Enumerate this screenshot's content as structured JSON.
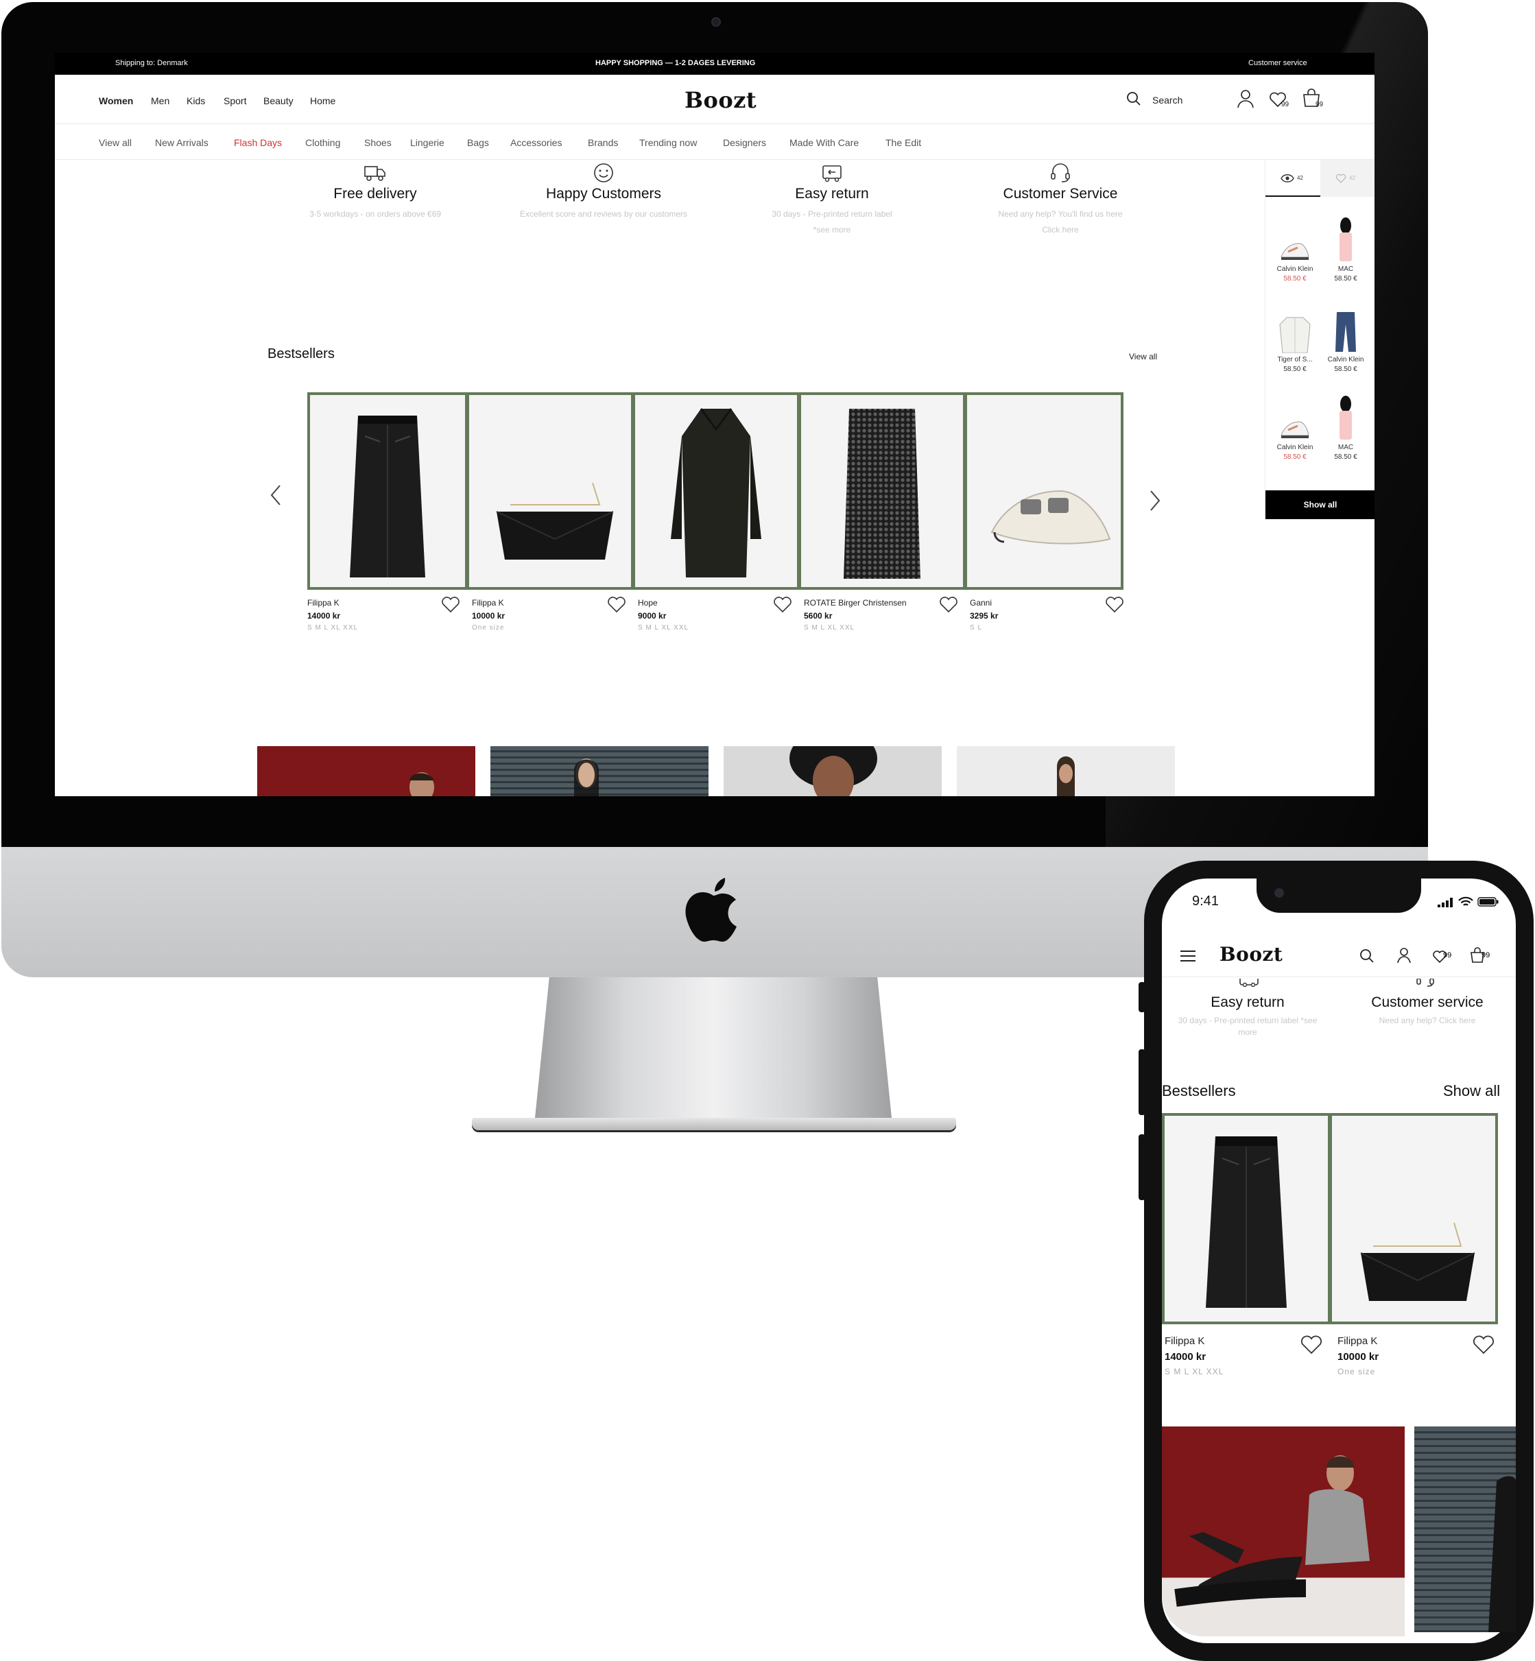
{
  "desktop": {
    "topbar": {
      "shipping": "Shipping to: Denmark",
      "promo": "HAPPY SHOPPING — 1-2 DAGES LEVERING",
      "service": "Customer service"
    },
    "header": {
      "nav": [
        "Women",
        "Men",
        "Kids",
        "Sport",
        "Beauty",
        "Home"
      ],
      "logo": "Boozt",
      "search_label": "Search",
      "wishlist_count": "99",
      "cart_count": "99"
    },
    "subnav": [
      "View all",
      "New Arrivals",
      "Flash Days",
      "Clothing",
      "Shoes",
      "Lingerie",
      "Bags",
      "Accessories",
      "Brands",
      "Trending now",
      "Designers",
      "Made With Care",
      "The Edit"
    ],
    "usps": [
      {
        "icon": "truck-icon",
        "title": "Free delivery",
        "desc": "3-5 workdays - on orders above €69",
        "desc2": ""
      },
      {
        "icon": "smiley-icon",
        "title": "Happy Customers",
        "desc": "Excellent score and reviews by our customers",
        "desc2": ""
      },
      {
        "icon": "return-icon",
        "title": "Easy return",
        "desc": "30 days - Pre-printed return label",
        "desc2": "*see more"
      },
      {
        "icon": "headset-icon",
        "title": "Customer Service",
        "desc": "Need any help? You'll find us here",
        "desc2": "Click here"
      }
    ],
    "bestsellers": {
      "title": "Bestsellers",
      "view_all": "View all",
      "products": [
        {
          "brand": "Filippa K",
          "price": "14000 kr",
          "sizes": "S M L XL XXL",
          "image": "leather-skirt"
        },
        {
          "brand": "Filippa K",
          "price": "10000 kr",
          "sizes": "One size",
          "image": "leather-bag"
        },
        {
          "brand": "Hope",
          "price": "9000 kr",
          "sizes": "S M L XL XXL",
          "image": "long-coat"
        },
        {
          "brand": "ROTATE Birger Christensen",
          "price": "5600 kr",
          "sizes": "S M L XL XXL",
          "image": "sequin-dress"
        },
        {
          "brand": "Ganni",
          "price": "3295 kr",
          "sizes": "S L",
          "image": "buckle-flats"
        }
      ]
    },
    "recently_viewed": {
      "viewed_count": "42",
      "liked_count": "42",
      "items": [
        {
          "name": "Calvin Klein",
          "price": "58.50 €",
          "sale": true,
          "image": "sneaker"
        },
        {
          "name": "MAC",
          "price": "58.50 €",
          "sale": false,
          "image": "perfume"
        },
        {
          "name": "Tiger of S...",
          "price": "58.50 €",
          "sale": false,
          "image": "jacket"
        },
        {
          "name": "Calvin Klein",
          "price": "58.50 €",
          "sale": false,
          "image": "jeans"
        },
        {
          "name": "Calvin Klein",
          "price": "58.50 €",
          "sale": true,
          "image": "sneaker"
        },
        {
          "name": "MAC",
          "price": "58.50 €",
          "sale": false,
          "image": "perfume"
        }
      ],
      "show_all": "Show all"
    }
  },
  "mobile": {
    "status": {
      "time": "9:41"
    },
    "header": {
      "logo": "Boozt",
      "wishlist_count": "99",
      "cart_count": "99"
    },
    "usps": [
      {
        "title": "Easy return",
        "desc": "30 days - Pre-printed return label *see more"
      },
      {
        "title": "Customer service",
        "desc": "Need any help? Click here"
      }
    ],
    "bestsellers": {
      "title": "Bestsellers",
      "show_all": "Show all",
      "products": [
        {
          "brand": "Filippa K",
          "price": "14000 kr",
          "sizes": "S M L XL XXL"
        },
        {
          "brand": "Filippa K",
          "price": "10000 kr",
          "sizes": "One size"
        }
      ]
    }
  },
  "colors": {
    "accent_red": "#d0312d",
    "card_border": "#637a58",
    "sale_red": "#d9534f"
  }
}
